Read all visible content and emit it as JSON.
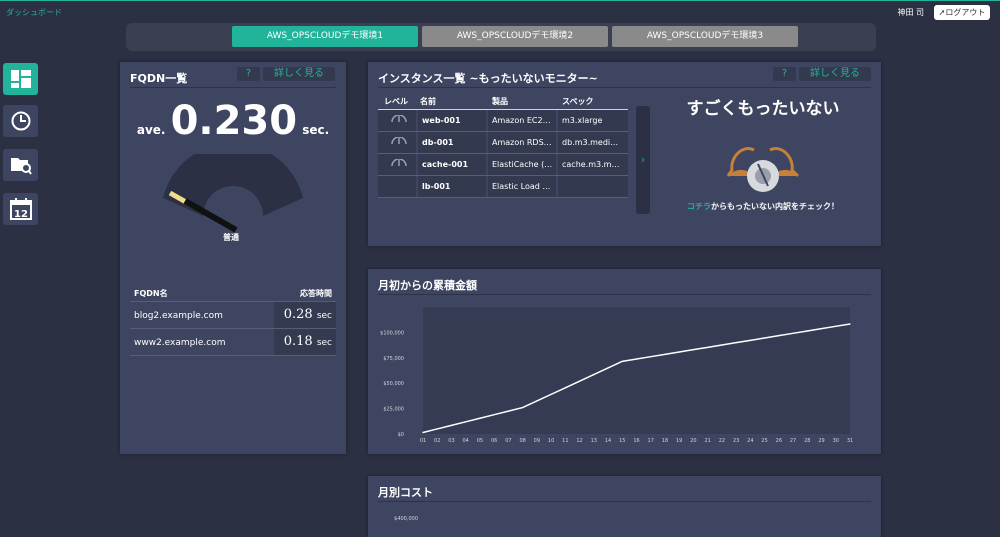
{
  "header": {
    "breadcrumb": "ダッシュボード",
    "user_name": "神田 司",
    "logout_label": "ログアウト"
  },
  "env_tabs": [
    {
      "label": "AWS_OPSCLOUDデモ環境1",
      "active": true
    },
    {
      "label": "AWS_OPSCLOUDデモ環境2",
      "active": false
    },
    {
      "label": "AWS_OPSCLOUDデモ環境3",
      "active": false
    }
  ],
  "sidebar": [
    {
      "icon": "dashboard-icon",
      "active": true
    },
    {
      "icon": "clock-icon",
      "active": false
    },
    {
      "icon": "folder-search-icon",
      "active": false
    },
    {
      "icon": "calendar-icon",
      "active": false,
      "calendar_day": "12"
    }
  ],
  "fqdn": {
    "title": "FQDN一覧",
    "help": "?",
    "more": "詳しく見る",
    "avg_prefix": "ave.",
    "avg_value": "0.230",
    "avg_unit": "sec.",
    "gauge_label": "普通",
    "col_name": "FQDN名",
    "col_time": "応答時間",
    "rows": [
      {
        "name": "blog2.example.com",
        "value": "0.28",
        "unit": "sec"
      },
      {
        "name": "www2.example.com",
        "value": "0.18",
        "unit": "sec"
      }
    ]
  },
  "instances": {
    "title": "インスタンス一覧 ~もったいないモニター~",
    "help": "?",
    "more": "詳しく見る",
    "columns": [
      "レベル",
      "名前",
      "製品",
      "スペック"
    ],
    "rows": [
      {
        "name": "web-001",
        "product": "Amazon EC2…",
        "spec": "m3.xlarge",
        "has_level": true
      },
      {
        "name": "db-001",
        "product": "Amazon RDS…",
        "spec": "db.m3.medi…",
        "has_level": true
      },
      {
        "name": "cache-001",
        "product": "ElastiCache (…",
        "spec": "cache.m3.m…",
        "has_level": true
      },
      {
        "name": "lb-001",
        "product": "Elastic Load …",
        "spec": "",
        "has_level": false
      }
    ],
    "pager": "›",
    "motto": "すごくもったいない",
    "check_link": "コチラ",
    "check_rest": "からもったいない内訳をチェック！"
  },
  "cumulative": {
    "title": "月初からの累積金額",
    "chart_data": {
      "type": "line",
      "x": [
        "01",
        "02",
        "03",
        "04",
        "05",
        "06",
        "07",
        "08",
        "09",
        "10",
        "11",
        "12",
        "13",
        "14",
        "15",
        "16",
        "17",
        "18",
        "19",
        "20",
        "21",
        "22",
        "23",
        "24",
        "25",
        "26",
        "27",
        "28",
        "29",
        "30",
        "31"
      ],
      "series": [
        {
          "values": [
            1500,
            5000,
            8500,
            12000,
            15500,
            19000,
            22500,
            26000,
            32500,
            39000,
            45500,
            52000,
            58500,
            65000,
            71500,
            73800,
            76100,
            78400,
            80700,
            83000,
            85300,
            87600,
            89900,
            92200,
            94500,
            96800,
            99100,
            101400,
            103700,
            106000,
            108300
          ]
        }
      ],
      "y_ticks": [
        "$0",
        "$25,000",
        "$50,000",
        "$75,000",
        "$100,000"
      ],
      "ylim": [
        0,
        125000
      ],
      "grid": false,
      "line_color": "#ffffff",
      "plot_bg": "#353b52"
    }
  },
  "monthly": {
    "title": "月別コスト",
    "y_top_tick": "$400,000"
  }
}
